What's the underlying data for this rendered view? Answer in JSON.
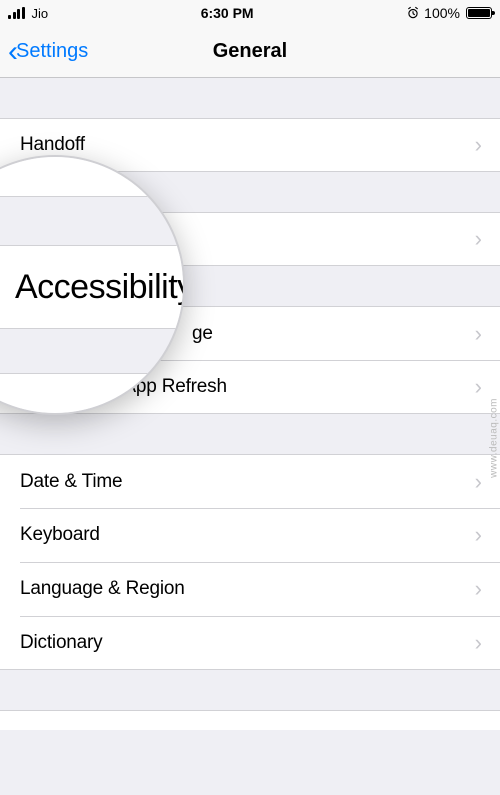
{
  "status_bar": {
    "carrier": "Jio",
    "time": "6:30 PM",
    "battery_percent": "100%"
  },
  "nav": {
    "back_label": "Settings",
    "title": "General"
  },
  "magnifier": {
    "label": "Accessibility"
  },
  "groups": [
    {
      "rows": [
        {
          "label": "Handoff"
        }
      ]
    },
    {
      "rows": [
        {
          "label": "Accessibility"
        }
      ]
    },
    {
      "rows": [
        {
          "label_partial": "ge"
        },
        {
          "label": "Background App Refresh"
        }
      ]
    },
    {
      "rows": [
        {
          "label": "Date & Time"
        },
        {
          "label": "Keyboard"
        },
        {
          "label": "Language & Region"
        },
        {
          "label": "Dictionary"
        }
      ]
    }
  ],
  "watermark": "www.deuaq.com"
}
